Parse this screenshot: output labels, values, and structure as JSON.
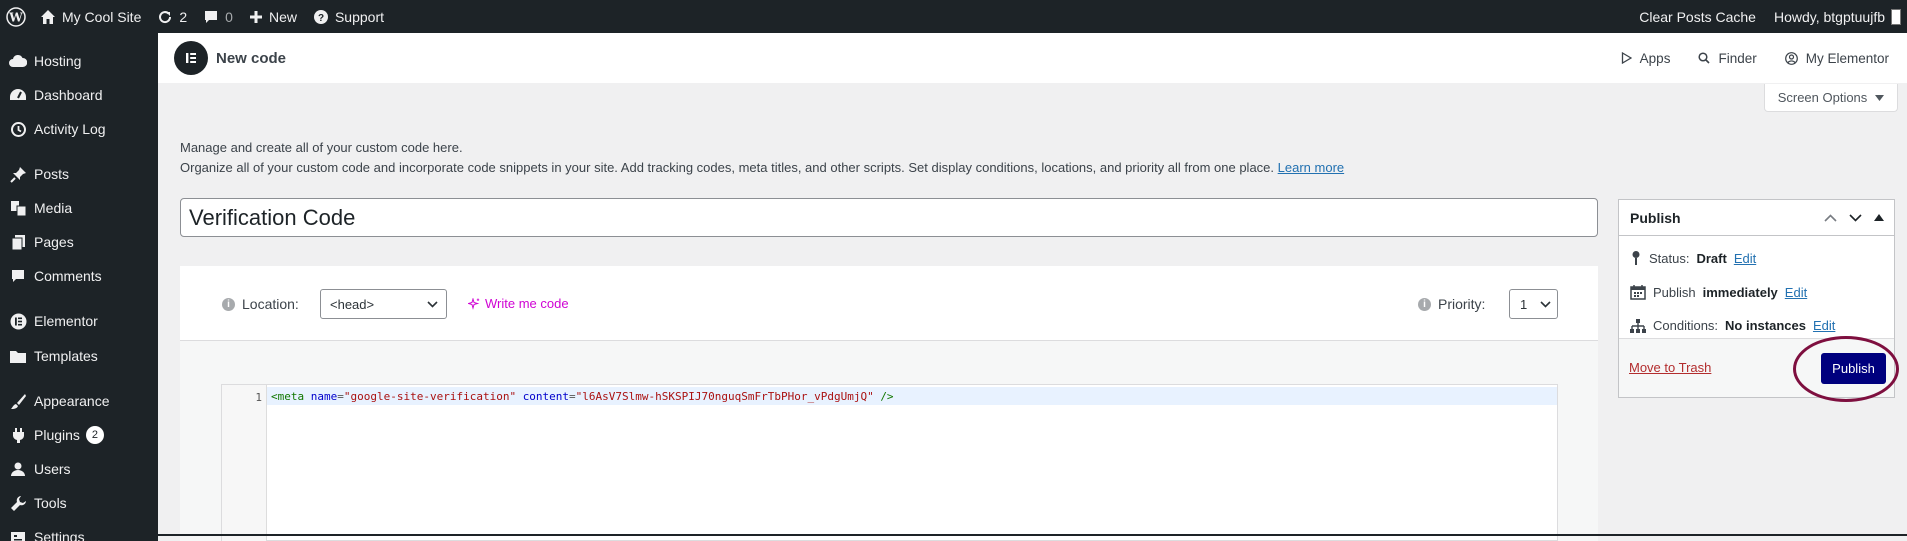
{
  "adminbar": {
    "site_name": "My Cool Site",
    "updates_count": "2",
    "comments_count": "0",
    "new_label": "New",
    "support_label": "Support",
    "clear_cache_label": "Clear Posts Cache",
    "howdy_label": "Howdy, btgptuujfb"
  },
  "sidebar": {
    "items": [
      {
        "label": "Hosting",
        "icon": "cloud-icon"
      },
      {
        "label": "Dashboard",
        "icon": "dashboard-icon"
      },
      {
        "label": "Activity Log",
        "icon": "history-icon"
      },
      {
        "label": "Posts",
        "icon": "pin-icon"
      },
      {
        "label": "Media",
        "icon": "media-icon"
      },
      {
        "label": "Pages",
        "icon": "pages-icon"
      },
      {
        "label": "Comments",
        "icon": "comment-icon"
      },
      {
        "label": "Elementor",
        "icon": "elementor-icon"
      },
      {
        "label": "Templates",
        "icon": "folder-icon"
      },
      {
        "label": "Appearance",
        "icon": "brush-icon"
      },
      {
        "label": "Plugins",
        "icon": "plugin-icon",
        "badge": "2"
      },
      {
        "label": "Users",
        "icon": "user-icon"
      },
      {
        "label": "Tools",
        "icon": "wrench-icon"
      },
      {
        "label": "Settings",
        "icon": "settings-icon"
      }
    ]
  },
  "topbar": {
    "title": "New code",
    "apps_label": "Apps",
    "finder_label": "Finder",
    "my_elementor_label": "My Elementor"
  },
  "screen_options": {
    "label": "Screen Options"
  },
  "intro": {
    "line1": "Manage and create all of your custom code here.",
    "line2": "Organize all of your custom code and incorporate code snippets in your site. Add tracking codes, meta titles, and other scripts. Set display conditions, locations, and priority all from one place.",
    "learn_more": "Learn more"
  },
  "title_input": {
    "value": "Verification Code"
  },
  "code_settings": {
    "location_label": "Location:",
    "location_value": "<head>",
    "write_code_label": "Write me code",
    "priority_label": "Priority:",
    "priority_value": "1"
  },
  "editor": {
    "line_number": "1",
    "tokens": {
      "open": "<meta",
      "attr_name": "name",
      "eq1": "=",
      "name_value": "\"google-site-verification\"",
      "attr_content": "content",
      "eq2": "=",
      "content_value": "\"l6AsV7Slmw-hSKSPIJ70nguqSmFrTbPHor_vPdgUmjQ\"",
      "close": "/>"
    }
  },
  "publish": {
    "title": "Publish",
    "status_label": "Status:",
    "status_value": "Draft",
    "publish_label": "Publish",
    "publish_value": "immediately",
    "conditions_label": "Conditions:",
    "conditions_value": "No instances",
    "edit_label": "Edit",
    "trash_label": "Move to Trash",
    "publish_button": "Publish"
  },
  "colors": {
    "admin_bg": "#1d2327",
    "publish_button": "#00007e",
    "annotation_circle": "#7e0f3f",
    "write_code_accent": "#d004d4",
    "link": "#2271b1"
  }
}
